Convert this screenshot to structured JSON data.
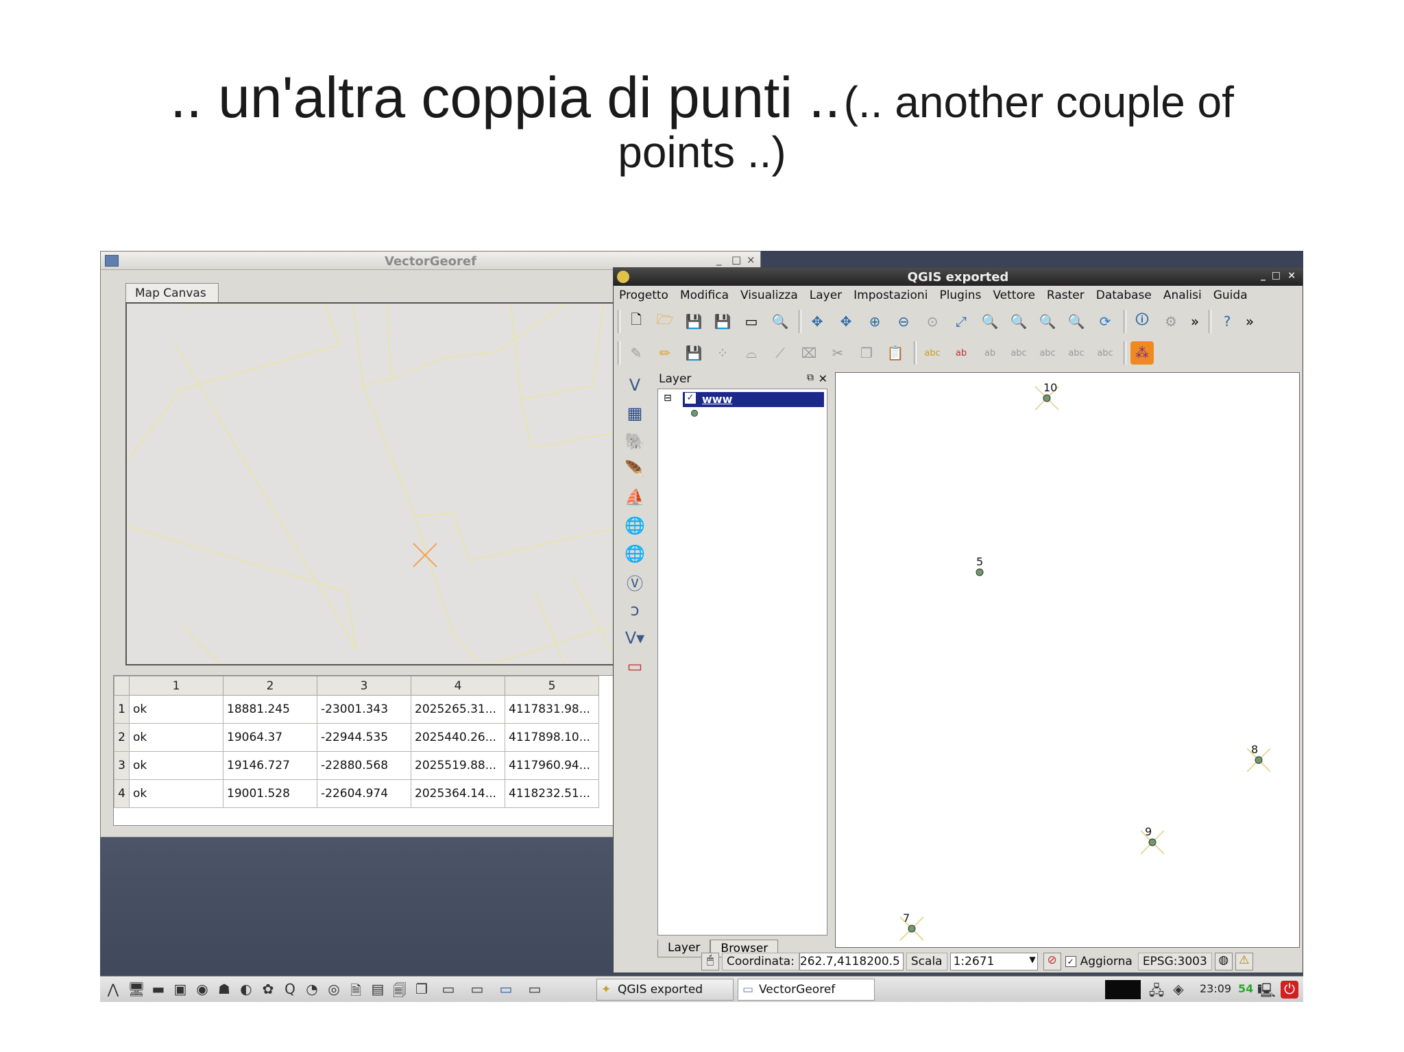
{
  "slide": {
    "title_main": ".. un'altra coppia di punti ..",
    "title_sub": "(.. another couple of",
    "title_line2": "points ..)"
  },
  "vectorgeoref": {
    "title": "VectorGeoref",
    "tab_label": "Map Canvas",
    "table": {
      "columns": [
        "1",
        "2",
        "3",
        "4",
        "5"
      ],
      "rows": [
        {
          "index": "1",
          "cells": [
            "ok",
            "18881.245",
            "-23001.343",
            "2025265.31...",
            "4117831.98..."
          ]
        },
        {
          "index": "2",
          "cells": [
            "ok",
            "19064.37",
            "-22944.535",
            "2025440.26...",
            "4117898.10..."
          ]
        },
        {
          "index": "3",
          "cells": [
            "ok",
            "19146.727",
            "-22880.568",
            "2025519.88...",
            "4117960.94..."
          ]
        },
        {
          "index": "4",
          "cells": [
            "ok",
            "19001.528",
            "-22604.974",
            "2025364.14...",
            "4118232.51..."
          ]
        }
      ]
    }
  },
  "qgis": {
    "title": "QGIS exported",
    "menu": [
      "Progetto",
      "Modifica",
      "Visualizza",
      "Layer",
      "Impostazioni",
      "Plugins",
      "Vettore",
      "Raster",
      "Database",
      "Analisi",
      "Guida"
    ],
    "layer_panel": {
      "header": "Layer",
      "layer_name": "www",
      "tabs": [
        "Layer",
        "Browser"
      ]
    },
    "map_points": [
      "10",
      "5",
      "8",
      "9",
      "7"
    ],
    "status": {
      "coord_label": "Coordinata:",
      "coord_value": "262.7,4118200.5",
      "scale_label": "Scala",
      "scale_value": "1:2671",
      "update_label": "Aggiorna",
      "crs": "EPSG:3003"
    }
  },
  "taskbar": {
    "windows": [
      "QGIS exported",
      "VectorGeoref"
    ],
    "clock": "23:09",
    "counter": "54"
  },
  "colors": {
    "selection": "#1b2a8a",
    "point_fill": "#6f9a6e",
    "cross": "#e0a040"
  }
}
